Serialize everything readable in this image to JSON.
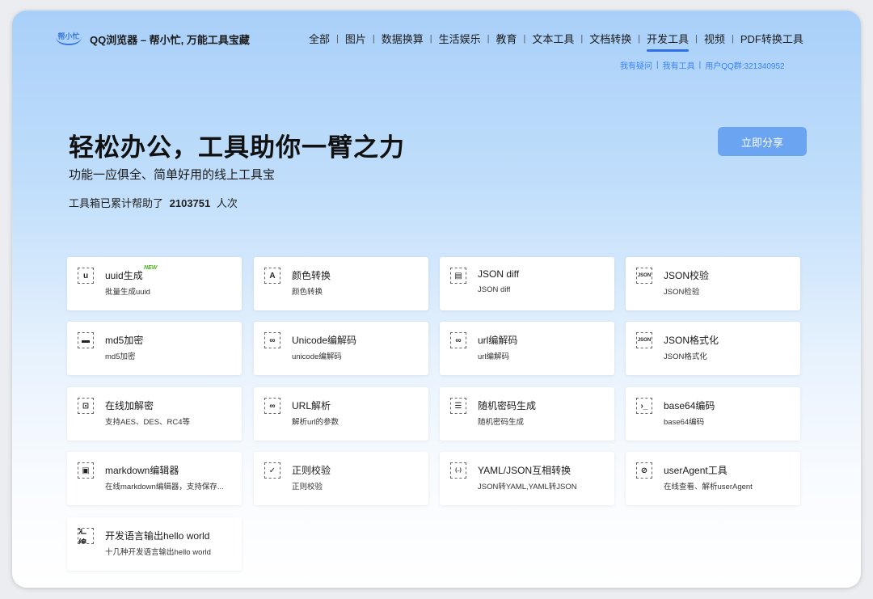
{
  "header": {
    "logo_text": "帮小忙",
    "site_title": "QQ浏览器 – 帮小忙, 万能工具宝藏",
    "nav": [
      {
        "label": "全部",
        "active": false
      },
      {
        "label": "图片",
        "active": false
      },
      {
        "label": "数据换算",
        "active": false
      },
      {
        "label": "生活娱乐",
        "active": false
      },
      {
        "label": "教育",
        "active": false
      },
      {
        "label": "文本工具",
        "active": false
      },
      {
        "label": "文档转换",
        "active": false
      },
      {
        "label": "开发工具",
        "active": true
      },
      {
        "label": "视频",
        "active": false
      },
      {
        "label": "PDF转换工具",
        "active": false
      }
    ],
    "sublinks": [
      "我有疑问",
      "我有工具",
      "用户QQ群:321340952"
    ]
  },
  "hero": {
    "title": "轻松办公，工具助你一臂之力",
    "subtitle": "功能一应俱全、简单好用的线上工具宝",
    "count_prefix": "工具箱已累计帮助了",
    "count_value": "2103751",
    "count_suffix": "人次",
    "share_button": "立即分享"
  },
  "tools": [
    {
      "icon": "u",
      "icon_name": "uuid-icon",
      "title": "uuid生成",
      "desc": "批量生成uuid",
      "badge": "NEW"
    },
    {
      "icon": "A",
      "icon_name": "color-icon",
      "title": "颜色转换",
      "desc": "颜色转换"
    },
    {
      "icon": "▤",
      "icon_name": "document-icon",
      "title": "JSON diff",
      "desc": "JSON diff"
    },
    {
      "icon": "JSON",
      "icon_name": "json-file-icon",
      "title": "JSON校验",
      "desc": "JSON检验"
    },
    {
      "icon": "▬",
      "icon_name": "md5-icon",
      "title": "md5加密",
      "desc": "md5加密"
    },
    {
      "icon": "∞",
      "icon_name": "link-icon",
      "title": "Unicode编解码",
      "desc": "unicode编解码"
    },
    {
      "icon": "∞",
      "icon_name": "link-icon",
      "title": "url编解码",
      "desc": "url编解码"
    },
    {
      "icon": "JSON",
      "icon_name": "json-file-icon",
      "title": "JSON格式化",
      "desc": "JSON格式化"
    },
    {
      "icon": "⊡",
      "icon_name": "lock-icon",
      "title": "在线加解密",
      "desc": "支持AES、DES、RC4等"
    },
    {
      "icon": "∞",
      "icon_name": "link-icon",
      "title": "URL解析",
      "desc": "解析url的参数"
    },
    {
      "icon": "☰",
      "icon_name": "clipboard-icon",
      "title": "随机密码生成",
      "desc": "随机密码生成"
    },
    {
      "icon": "›_",
      "icon_name": "terminal-icon",
      "title": "base64编码",
      "desc": "base64编码"
    },
    {
      "icon": "▣",
      "icon_name": "markdown-icon",
      "title": "markdown编辑器",
      "desc": "在线markdown编辑器，支持保存..."
    },
    {
      "icon": "✓",
      "icon_name": "regex-icon",
      "title": "正则校验",
      "desc": "正则校验"
    },
    {
      "icon": "{..}",
      "icon_name": "braces-icon",
      "title": "YAML/JSON互相转换",
      "desc": "JSON转YAML,YAML转JSON"
    },
    {
      "icon": "⊘",
      "icon_name": "compass-icon",
      "title": "userAgent工具",
      "desc": "在线查看、解析userAgent"
    },
    {
      "icon": "汇编",
      "icon_name": "assembly-icon",
      "title": "开发语言输出hello world",
      "desc": "十几种开发语言输出hello world"
    }
  ]
}
